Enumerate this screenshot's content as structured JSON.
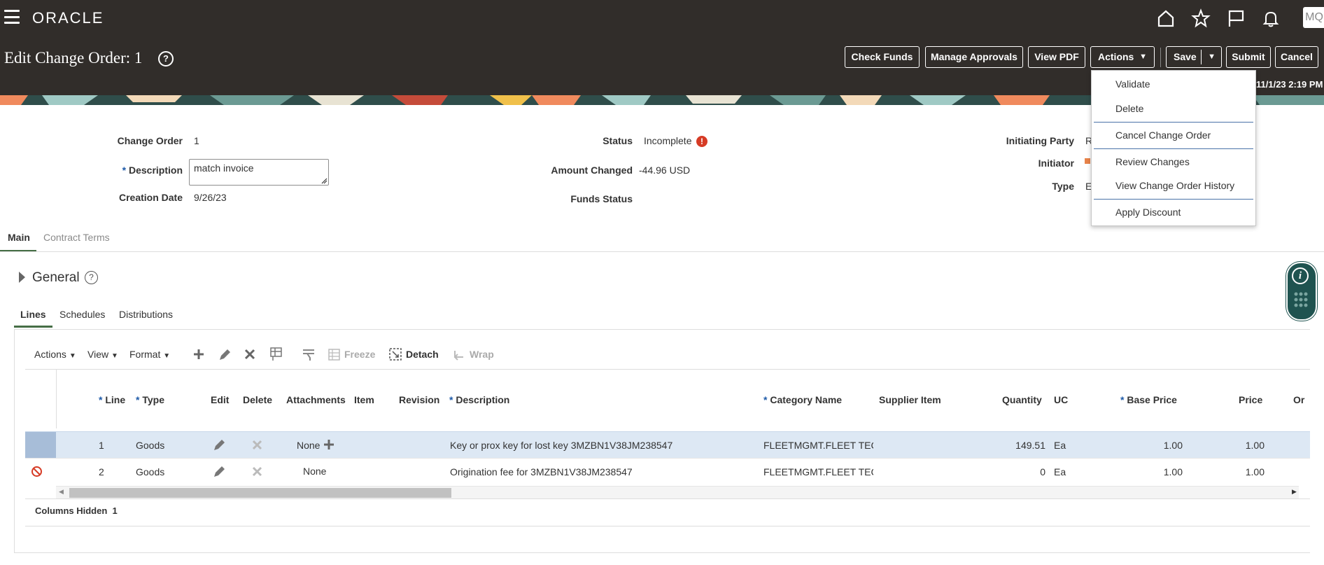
{
  "app": {
    "logo": "ORACLE",
    "user_initials": "MQ"
  },
  "header_icons": [
    "home-icon",
    "star-icon",
    "flag-icon",
    "bell-icon"
  ],
  "page": {
    "title": "Edit Change Order: 1",
    "datetime": "11/1/23 2:19 PM"
  },
  "buttons": {
    "check_funds": "Check Funds",
    "manage_approvals": "Manage Approvals",
    "view_pdf": "View PDF",
    "actions": "Actions",
    "save": "Save",
    "submit": "Submit",
    "cancel": "Cancel"
  },
  "actions_menu": {
    "items": [
      "Validate",
      "Delete",
      "Cancel Change Order",
      "Review Changes",
      "View Change Order History",
      "Apply Discount"
    ]
  },
  "form": {
    "change_order_label": "Change Order",
    "change_order_value": "1",
    "description_label": "Description",
    "description_value": "match invoice",
    "creation_date_label": "Creation Date",
    "creation_date_value": "9/26/23",
    "status_label": "Status",
    "status_value": "Incomplete",
    "amount_changed_label": "Amount Changed",
    "amount_changed_value": "-44.96",
    "amount_changed_currency": "USD",
    "funds_status_label": "Funds Status",
    "initiating_party_label": "Initiating Party",
    "initiating_party_value": "R",
    "initiator_label": "Initiator",
    "type_label": "Type",
    "type_value": "E"
  },
  "tabs": {
    "main": "Main",
    "contract_terms": "Contract Terms"
  },
  "general_section": {
    "title": "General"
  },
  "subtabs": {
    "lines": "Lines",
    "schedules": "Schedules",
    "distributions": "Distributions"
  },
  "toolbar": {
    "actions": "Actions",
    "view": "View",
    "format": "Format",
    "freeze": "Freeze",
    "detach": "Detach",
    "wrap": "Wrap"
  },
  "table": {
    "headers": {
      "line": "Line",
      "type": "Type",
      "edit": "Edit",
      "delete": "Delete",
      "attachments": "Attachments",
      "item": "Item",
      "revision": "Revision",
      "description": "Description",
      "category_name": "Category Name",
      "supplier_item": "Supplier Item",
      "quantity": "Quantity",
      "uom": "UC",
      "base_price": "Base Price",
      "price": "Price",
      "or": "Or"
    },
    "rows": [
      {
        "line": "1",
        "type": "Goods",
        "attachments": "None",
        "description": "Key or prox key for lost key 3MZBN1V38JM238547",
        "category": "FLEETMGMT.FLEET TEC",
        "quantity": "149.51",
        "uom": "Ea",
        "base_price": "1.00",
        "price": "1.00"
      },
      {
        "line": "2",
        "type": "Goods",
        "attachments": "None",
        "description": "Origination fee for 3MZBN1V38JM238547",
        "category": "FLEETMGMT.FLEET TEC",
        "quantity": "0",
        "uom": "Ea",
        "base_price": "1.00",
        "price": "1.00"
      }
    ],
    "columns_hidden_label": "Columns Hidden",
    "columns_hidden_value": "1"
  }
}
